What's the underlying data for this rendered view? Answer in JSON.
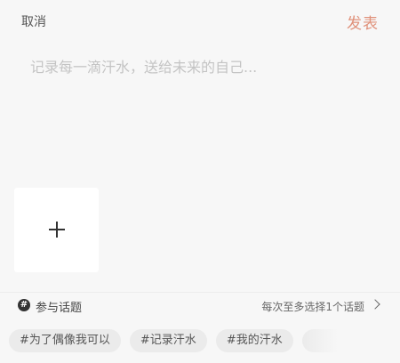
{
  "header": {
    "cancel_label": "取消",
    "publish_label": "发表"
  },
  "composer": {
    "placeholder": "记录每一滴汗水，送给未来的自己...",
    "value": ""
  },
  "add_photo": {
    "icon": "plus-icon"
  },
  "topics": {
    "icon": "hashtag-icon",
    "icon_glyph": "#",
    "label": "参与话题",
    "hint": "每次至多选择1个话题",
    "suggestions": [
      "#为了偶像我可以",
      "#记录汗水",
      "#我的汗水"
    ]
  },
  "colors": {
    "accent": "#e0917a",
    "background": "#f7f7f7",
    "placeholder": "#c4c4c4"
  }
}
